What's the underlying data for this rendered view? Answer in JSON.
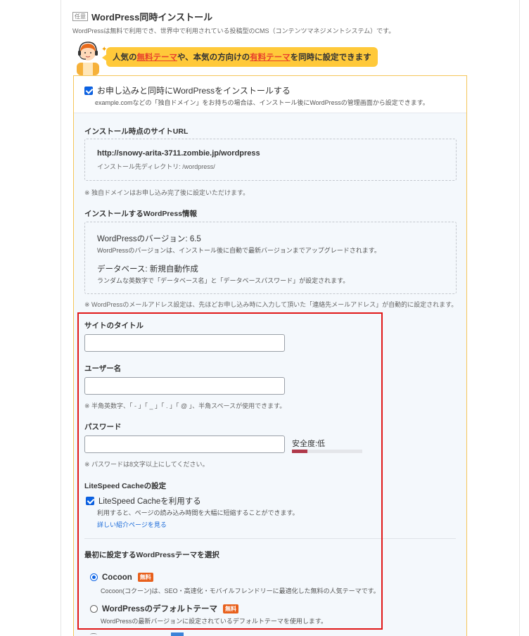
{
  "section": {
    "badge": "任意",
    "title": "WordPress同時インストール",
    "description": "WordPressは無料で利用でき、世界中で利用されている投稿型のCMS（コンテンツマネジメントシステム）です。"
  },
  "promo": {
    "prefix": "人気の",
    "highlight1": "無料テーマ",
    "middle": "や、本気の方向けの",
    "highlight2": "有料テーマ",
    "suffix": "を同時に設定できます"
  },
  "install": {
    "checkbox_label": "お申し込みと同時にWordPressをインストールする",
    "checkbox_desc": "example.comなどの「独自ドメイン」をお持ちの場合は、インストール後にWordPressの管理画面から設定できます。",
    "checked": true
  },
  "site_url": {
    "heading": "インストール時点のサイトURL",
    "url": "http://snowy-arita-3711.zombie.jp/wordpress",
    "directory": "インストール先ディレクトリ: /wordpress/",
    "note": "※ 独自ドメインはお申し込み完了後に設定いただけます。"
  },
  "wp_info": {
    "heading": "インストールするWordPress情報",
    "version_line": "WordPressのバージョン: 6.5",
    "version_desc": "WordPressのバージョンは、インストール後に自動で最新バージョンまでアップグレードされます。",
    "db_line": "データベース: 新規自動作成",
    "db_desc": "ランダムな英数字で「データベース名」と「データベースパスワード」が設定されます。",
    "note": "※ WordPressのメールアドレス設定は、先ほどお申し込み時に入力して頂いた「連絡先メールアドレス」が自動的に設定されます。"
  },
  "form": {
    "site_title_label": "サイトのタイトル",
    "site_title_value": "",
    "username_label": "ユーザー名",
    "username_value": "",
    "username_note": "※ 半角英数字、「 - 」「 _ 」「 . 」「 @ 」、半角スペースが使用できます。",
    "password_label": "パスワード",
    "password_value": "",
    "strength_label": "安全度:低",
    "strength_level": 0.22,
    "password_note": "※ パスワードは8文字以上にしてください。"
  },
  "litespeed": {
    "heading": "LiteSpeed Cacheの設定",
    "checkbox_label": "LiteSpeed Cacheを利用する",
    "checked": true,
    "desc": "利用すると、ページの読み込み時間を大幅に短縮することができます。",
    "link": "詳しい紹介ページを見る"
  },
  "theme": {
    "heading": "最初に設定するWordPressテーマを選択",
    "options": [
      {
        "name": "Cocoon",
        "badge": "無料",
        "desc": "Cocoon(コクーン)は、SEO・高速化・モバイルフレンドリーに最適化した無料の人気テーマです。",
        "selected": true
      },
      {
        "name": "WordPressのデフォルトテーマ",
        "badge": "無料",
        "desc": "WordPressの最新バージョンに設定されているデフォルトテーマを使用します。",
        "selected": false
      }
    ]
  },
  "colors": {
    "accent_yellow": "#ffc93a",
    "highlight_red": "#e8412c",
    "frame_red": "#e01818",
    "checkbox_blue": "#0b63e5",
    "badge_orange": "#e8601c"
  }
}
